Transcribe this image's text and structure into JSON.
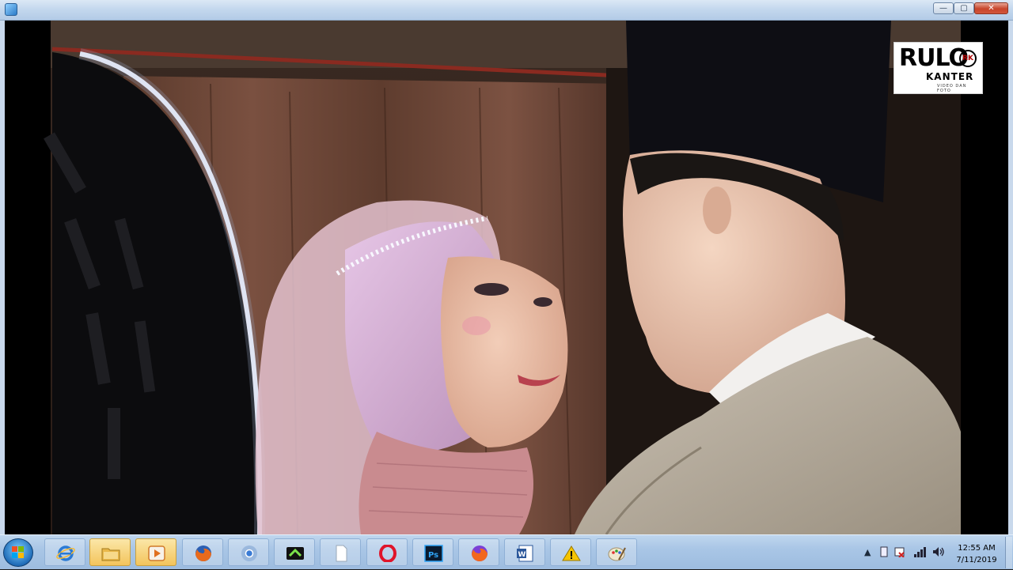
{
  "window": {
    "title": "",
    "buttons": {
      "minimize": "—",
      "maximize": "▢",
      "close": "✕"
    }
  },
  "video": {
    "watermark": {
      "main": "RULO",
      "badge": "RK",
      "sub": "KANTER",
      "tagline": "VIDEO DAN FOTO"
    }
  },
  "taskbar": {
    "start": "start-orb",
    "items": [
      {
        "icon": "internet-explorer-icon",
        "state": "pinned"
      },
      {
        "icon": "folder-icon",
        "state": "active"
      },
      {
        "icon": "media-player-icon",
        "state": "active"
      },
      {
        "icon": "firefox-icon",
        "state": "pinned"
      },
      {
        "icon": "chrome-icon",
        "state": "pinned"
      },
      {
        "icon": "video-editor-icon",
        "state": "pinned"
      },
      {
        "icon": "blank-document-icon",
        "state": "pinned"
      },
      {
        "icon": "opera-icon",
        "state": "pinned"
      },
      {
        "icon": "photoshop-icon",
        "state": "pinned"
      },
      {
        "icon": "firefox-icon",
        "state": "pinned"
      },
      {
        "icon": "word-icon",
        "state": "pinned"
      },
      {
        "icon": "warning-icon",
        "state": "pinned"
      },
      {
        "icon": "paint-icon",
        "state": "pinned"
      }
    ],
    "tray": {
      "time": "12:55 AM",
      "date": "7/11/2019"
    }
  },
  "colors": {
    "titlebar": "#c4d8ee",
    "taskbar": "#a9c6e6",
    "close": "#c7452b",
    "active_item": "#f3c45c"
  }
}
